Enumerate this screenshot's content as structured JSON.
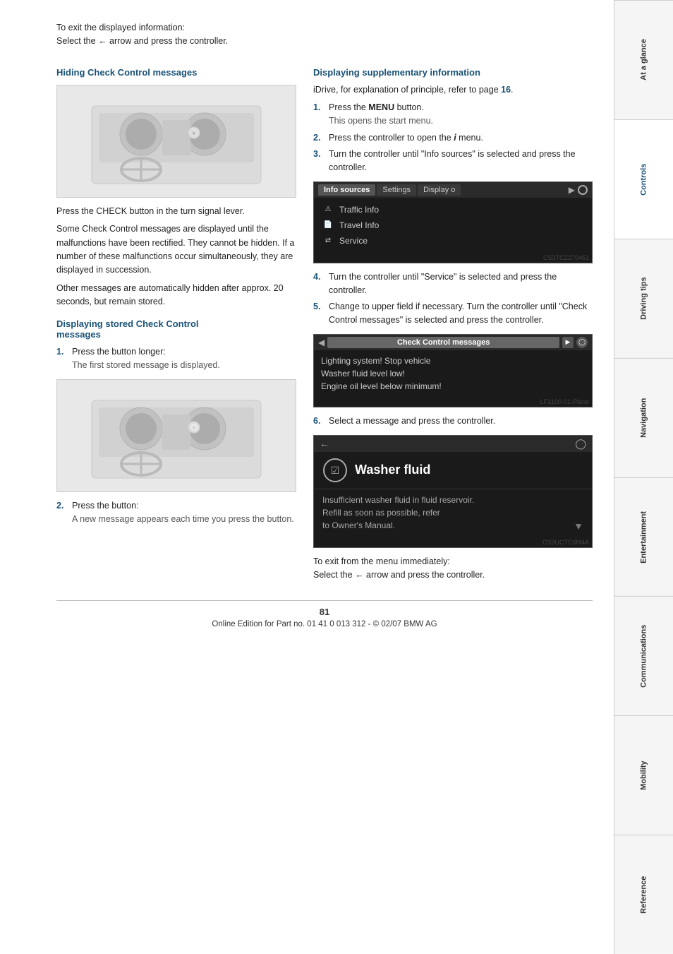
{
  "page": {
    "number": "81",
    "footer_text": "Online Edition for Part no. 01 41 0 013 312 - © 02/07 BMW AG"
  },
  "intro": {
    "exit_text": "To exit the displayed information:",
    "exit_instruction": "Select the ← arrow and press the controller."
  },
  "left_col": {
    "hiding_heading": "Hiding Check Control messages",
    "car_image_alt": "Car interior image showing dashboard",
    "press_check_text": "Press the CHECK button in the turn signal lever.",
    "para1": "Some Check Control messages are displayed until the malfunctions have been rectified. They cannot be hidden. If a number of these malfunctions occur simultaneously, they are displayed in succession.",
    "para2": "Other messages are automatically hidden after approx. 20 seconds, but remain stored.",
    "stored_heading_line1": "Displaying stored Check Control",
    "stored_heading_line2": "messages",
    "step1_num": "1.",
    "step1_text": "Press the button longer:",
    "step1_sub": "The first stored message is displayed.",
    "car_image2_alt": "Car interior image showing dashboard with button",
    "step2_num": "2.",
    "step2_text": "Press the button:",
    "step2_sub": "A new message appears each time you press the button."
  },
  "right_col": {
    "supp_heading": "Displaying supplementary information",
    "idrive_text": "iDrive, for explanation of principle, refer to page",
    "idrive_page": "16",
    "idrive_text_after": ".",
    "step1_num": "1.",
    "step1_text_a": "Press the",
    "step1_bold": "MENU",
    "step1_text_b": "button.",
    "step1_sub": "This opens the start menu.",
    "step2_num": "2.",
    "step2_text": "Press the controller to open the",
    "step2_icon": "i",
    "step2_text_b": "menu.",
    "step3_num": "3.",
    "step3_text": "Turn the controller until \"Info sources\" is selected and press the controller.",
    "info_sources_screen": {
      "tabs": [
        "Info sources",
        "Settings",
        "Display o"
      ],
      "active_tab": "Info sources",
      "items": [
        {
          "icon": "warning-triangle",
          "label": "Traffic Info"
        },
        {
          "icon": "info-box",
          "label": "Travel Info"
        },
        {
          "icon": "arrows",
          "label": "Service"
        }
      ]
    },
    "step4_num": "4.",
    "step4_text": "Turn the controller until \"Service\" is selected and press the controller.",
    "step5_num": "5.",
    "step5_text": "Change to upper field if necessary. Turn the controller until \"Check Control messages\" is selected and press the controller.",
    "cc_screen": {
      "title": "Check Control messages",
      "messages": [
        "Lighting system! Stop vehicle",
        "Washer fluid level low!",
        "Engine oil level below minimum!"
      ]
    },
    "step6_num": "6.",
    "step6_text": "Select a message and press the controller.",
    "detail_screen": {
      "title": "Washer fluid",
      "text": "Insufficient washer fluid in fluid reservoir.\nRefill as soon as possible, refer to Owner's Manual."
    },
    "exit2_text": "To exit from the menu immediately:",
    "exit2_instruction": "Select the ← arrow and press the controller."
  },
  "sidebar_tabs": [
    {
      "label": "At a glance",
      "active": false
    },
    {
      "label": "Controls",
      "active": true
    },
    {
      "label": "Driving tips",
      "active": false
    },
    {
      "label": "Navigation",
      "active": false
    },
    {
      "label": "Entertainment",
      "active": false
    },
    {
      "label": "Communications",
      "active": false
    },
    {
      "label": "Mobility",
      "active": false
    },
    {
      "label": "Reference",
      "active": false
    }
  ]
}
